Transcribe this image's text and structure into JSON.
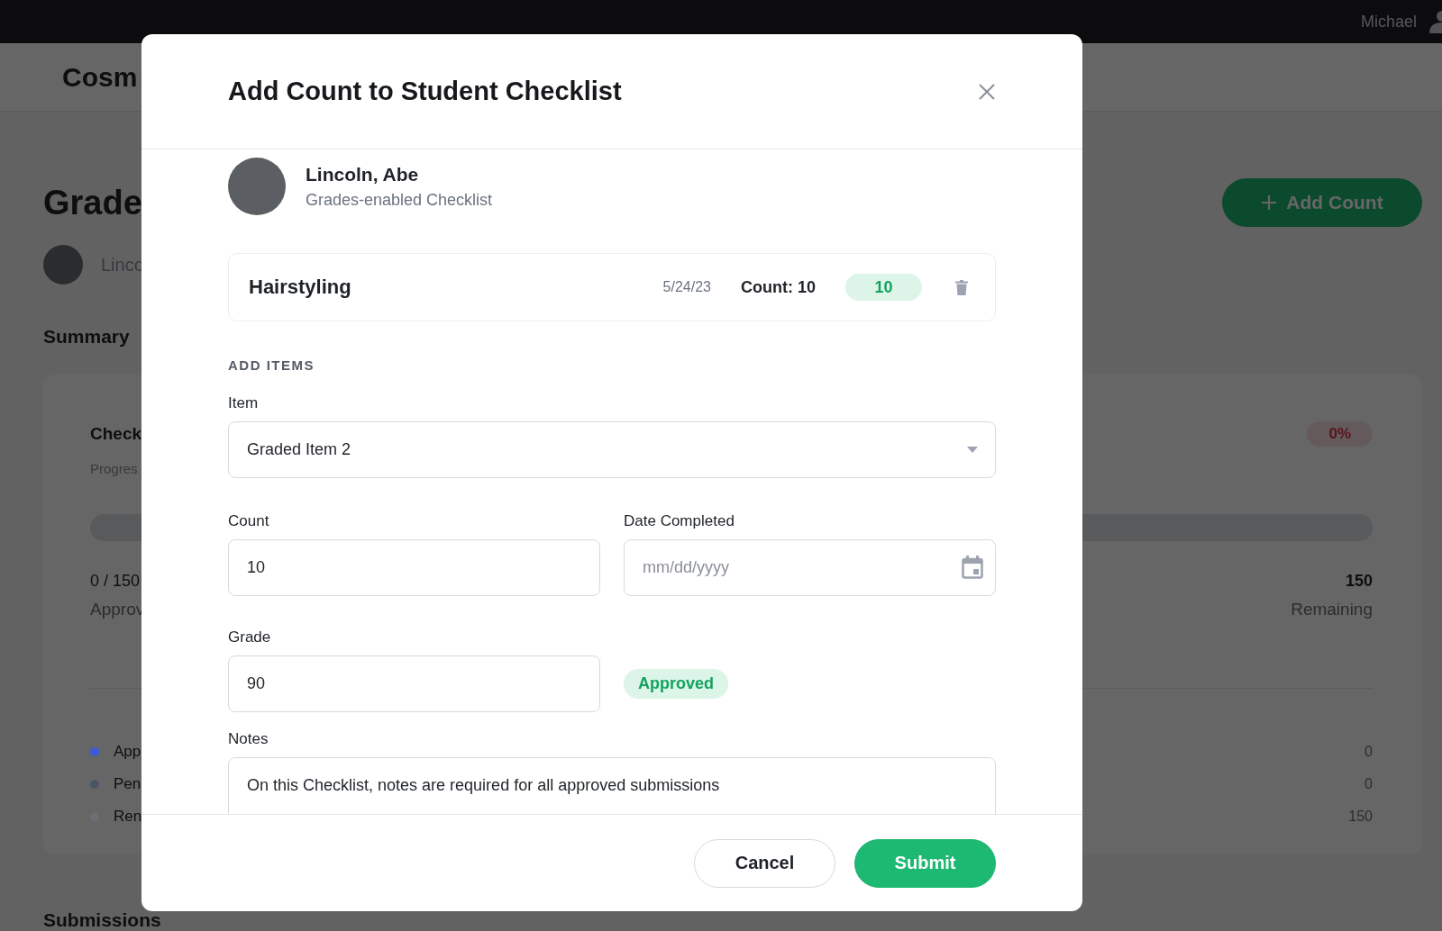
{
  "top_bar": {
    "user_name": "Michael"
  },
  "page": {
    "header_title": "Cosm",
    "title": "Grade",
    "student_name": "Linco",
    "add_button": "Add Count",
    "summary_heading": "Summary",
    "summary_card": {
      "title": "Check",
      "subtitle": "Progres",
      "percent_badge": "0%",
      "progress_text": "0 / 150",
      "progress_label": "Approv",
      "remaining_value": "150",
      "remaining_label": "Remaining",
      "legend": [
        {
          "label": "App",
          "value": "0",
          "color": "#3b5bdb"
        },
        {
          "label": "Pen",
          "value": "0",
          "color": "#4b5563"
        },
        {
          "label": "Ren",
          "value": "150",
          "color": "#6b6f76"
        }
      ]
    },
    "submissions_heading": "Submissions"
  },
  "dialog": {
    "title": "Add Count to Student Checklist",
    "student": {
      "name": "Lincoln, Abe",
      "checklist": "Grades-enabled Checklist"
    },
    "entry": {
      "name": "Hairstyling",
      "date": "5/24/23",
      "count": "Count: 10",
      "badge": "10"
    },
    "section_heading": "ADD ITEMS",
    "item": {
      "label": "Item",
      "value": "Graded Item 2"
    },
    "count": {
      "label": "Count",
      "value": "10"
    },
    "date_completed": {
      "label": "Date Completed",
      "placeholder": "mm/dd/yyyy"
    },
    "grade": {
      "label": "Grade",
      "value": "90",
      "status": "Approved"
    },
    "notes": {
      "label": "Notes",
      "value": "On this Checklist, notes are required for all approved submissions"
    },
    "buttons": [
      {
        "label": "Cancel",
        "kind": "secondary"
      },
      {
        "label": "Submit",
        "kind": "primary"
      }
    ]
  }
}
